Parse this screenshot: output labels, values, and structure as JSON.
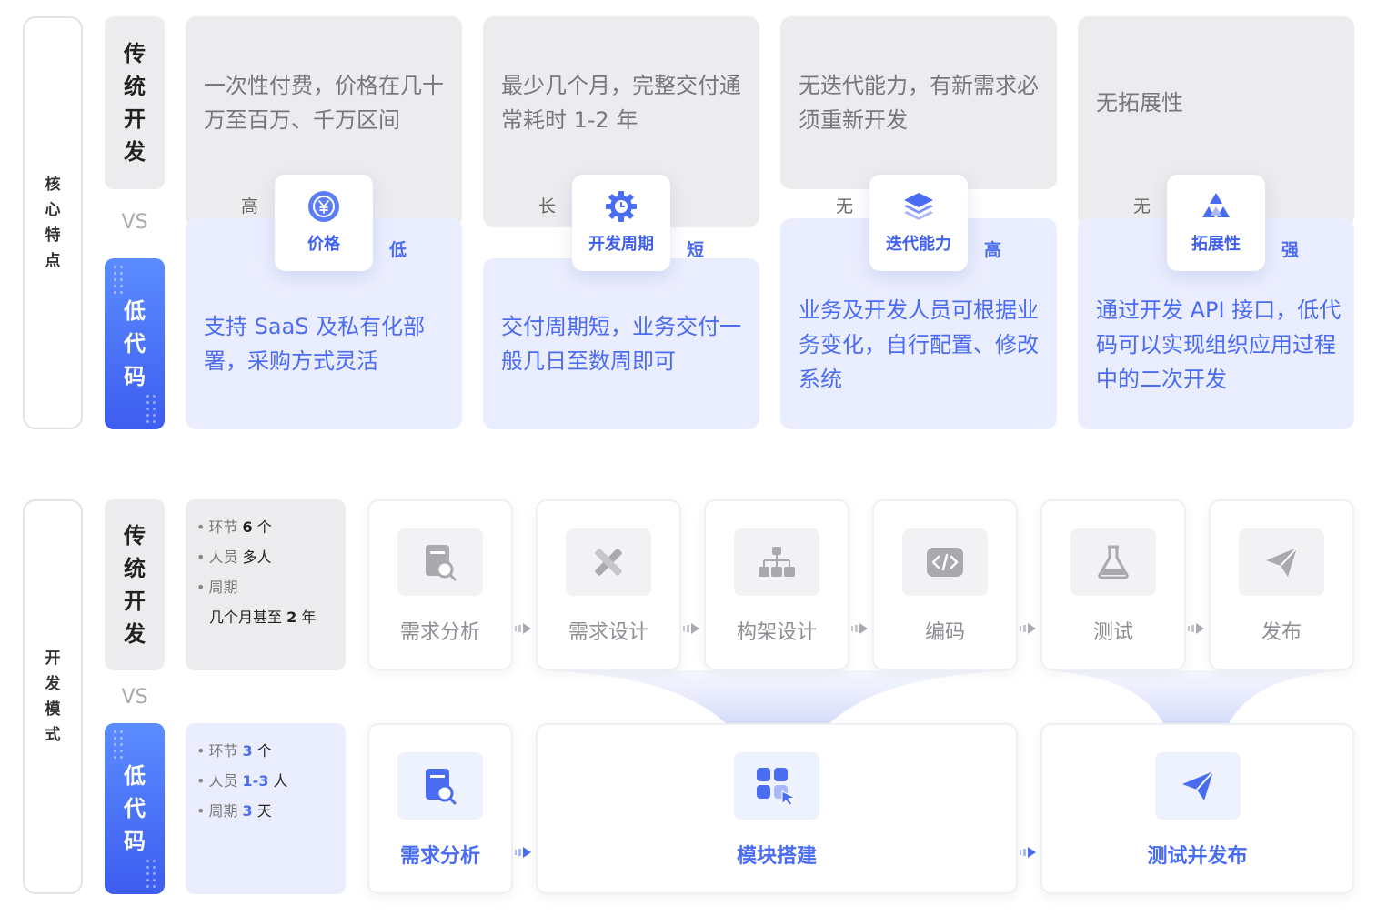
{
  "section_core": {
    "label": "核心特点"
  },
  "section_dev": {
    "label": "开发模式"
  },
  "tags": {
    "traditional": "传统开发",
    "lowcode": "低代码",
    "vs": "VS"
  },
  "features": [
    {
      "traditional_text": "一次性付费，价格在几十万至百万、千万区间",
      "lowcode_text": "支持 SaaS 及私有化部署，采购方式灵活",
      "badge": "价格",
      "icon": "yuan-icon",
      "traditional_level": "高",
      "lowcode_level": "低"
    },
    {
      "traditional_text": "最少几个月，完整交付通常耗时 1-2 年",
      "lowcode_text": "交付周期短，业务交付一般几日至数周即可",
      "badge": "开发周期",
      "icon": "gear-clock-icon",
      "traditional_level": "长",
      "lowcode_level": "短"
    },
    {
      "traditional_text": "无迭代能力，有新需求必须重新开发",
      "lowcode_text": "业务及开发人员可根据业务变化，自行配置、修改系统",
      "badge": "迭代能力",
      "icon": "layers-icon",
      "traditional_level": "无",
      "lowcode_level": "高"
    },
    {
      "traditional_text": "无拓展性",
      "lowcode_text": "通过开发 API 接口，低代码可以实现组织应用过程中的二次开发",
      "badge": "拓展性",
      "icon": "triangles-icon",
      "traditional_level": "无",
      "lowcode_level": "强"
    }
  ],
  "traditional_info": {
    "steps_prefix": "环节",
    "steps_value": "6",
    "steps_unit": "个",
    "people_prefix": "人员",
    "people_value": "多人",
    "period_prefix": "周期",
    "period_value": "几个月甚至",
    "period_num": "2",
    "period_unit": "年"
  },
  "lowcode_info": {
    "steps_prefix": "环节",
    "steps_value": "3",
    "steps_unit": "个",
    "people_prefix": "人员",
    "people_value": "1-3",
    "people_unit": "人",
    "period_prefix": "周期",
    "period_value": "3",
    "period_unit": "天"
  },
  "traditional_steps": [
    {
      "label": "需求分析",
      "icon": "doc-search-icon"
    },
    {
      "label": "需求设计",
      "icon": "pencil-ruler-icon"
    },
    {
      "label": "构架设计",
      "icon": "hierarchy-icon"
    },
    {
      "label": "编码",
      "icon": "code-icon"
    },
    {
      "label": "测试",
      "icon": "flask-icon"
    },
    {
      "label": "发布",
      "icon": "send-icon"
    }
  ],
  "lowcode_steps": [
    {
      "label": "需求分析",
      "icon": "doc-search-icon"
    },
    {
      "label": "模块搭建",
      "icon": "modules-icon"
    },
    {
      "label": "测试并发布",
      "icon": "send-icon"
    }
  ],
  "colors": {
    "accent": "#4b6cf0",
    "lowcode_gradient_top": "#5b8cff",
    "lowcode_gradient_bottom": "#3d5df0",
    "gray_card": "#ececee",
    "blue_card": "#eaedfd"
  }
}
